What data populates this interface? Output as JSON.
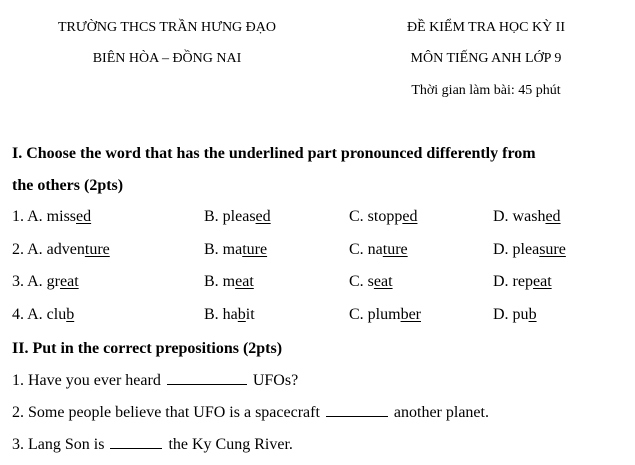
{
  "header": {
    "school_line1": "TRƯỜNG THCS TRẦN HƯNG ĐẠO",
    "school_line2": "BIÊN HÒA – ĐỒNG NAI",
    "exam_line1": "ĐỀ KIỂM TRA HỌC KỲ II",
    "exam_line2": "MÔN TIẾNG ANH LỚP 9",
    "exam_time": "Thời gian làm bài: 45 phút"
  },
  "section1": {
    "title_line1": "I. Choose the word that has the underlined part pronounced differently from",
    "title_line2": "the others (2pts)",
    "questions": [
      {
        "options": [
          {
            "pre": "1. A. miss",
            "u": "ed",
            "post": ""
          },
          {
            "pre": "B. pleas",
            "u": "ed",
            "post": ""
          },
          {
            "pre": "C. stopp",
            "u": "ed ",
            "post": ""
          },
          {
            "pre": "D. wash",
            "u": "ed",
            "post": ""
          }
        ]
      },
      {
        "options": [
          {
            "pre": "2. A. adven",
            "u": "ture",
            "post": ""
          },
          {
            "pre": "B. ma",
            "u": "ture",
            "post": ""
          },
          {
            "pre": "C. na",
            "u": "ture",
            "post": ""
          },
          {
            "pre": "D. plea",
            "u": "sure",
            "post": ""
          }
        ]
      },
      {
        "options": [
          {
            "pre": "3. A. gr",
            "u": "eat",
            "post": ""
          },
          {
            "pre": "B. m",
            "u": "eat",
            "post": ""
          },
          {
            "pre": "C. s",
            "u": "eat",
            "post": ""
          },
          {
            "pre": "D. rep",
            "u": "eat",
            "post": ""
          }
        ]
      },
      {
        "options": [
          {
            "pre": "4. A. clu",
            "u": "b",
            "post": ""
          },
          {
            "pre": "B. ha",
            "u": "b",
            "post": "it"
          },
          {
            "pre": "C. plum",
            "u": "ber",
            "post": ""
          },
          {
            "pre": "D. pu",
            "u": "b",
            "post": ""
          }
        ]
      }
    ]
  },
  "section2": {
    "title": "II. Put in the correct prepositions (2pts)",
    "q1_pre": "1. Have you ever heard",
    "q1_post": "UFOs?",
    "q2_pre": "2. Some people believe that UFO is a spacecraft",
    "q2_post": "another planet.",
    "q3_pre": "3. Lang Son is",
    "q3_post": "the Ky Cung River."
  }
}
